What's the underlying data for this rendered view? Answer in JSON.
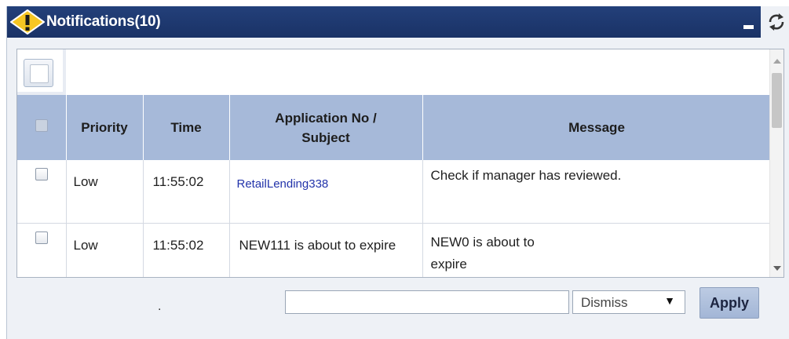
{
  "header": {
    "title": "Notifications(10)",
    "icons": {
      "warning": "warning-icon",
      "minimize": "minimize-icon",
      "refresh": "refresh-icon"
    },
    "bg_color": "#1f3a73"
  },
  "table": {
    "columns": [
      "",
      "Priority",
      "Time",
      "Application No / Subject",
      "Message"
    ],
    "column_lines": {
      "app_line1": "Application No /",
      "app_line2": "Subject"
    },
    "rows": [
      {
        "priority": "Low",
        "time": "11:55:02",
        "subject": "RetailLending338",
        "message": "Check if manager has reviewed."
      },
      {
        "priority": "Low",
        "time": "11:55:02",
        "subject": "NEW111 is about to expire",
        "message": "NEW0 is about to expire"
      }
    ],
    "header_color": "#a6b9d9"
  },
  "footer": {
    "dot": ".",
    "input_value": "",
    "action_selected": "Dismiss",
    "apply_label": "Apply"
  }
}
